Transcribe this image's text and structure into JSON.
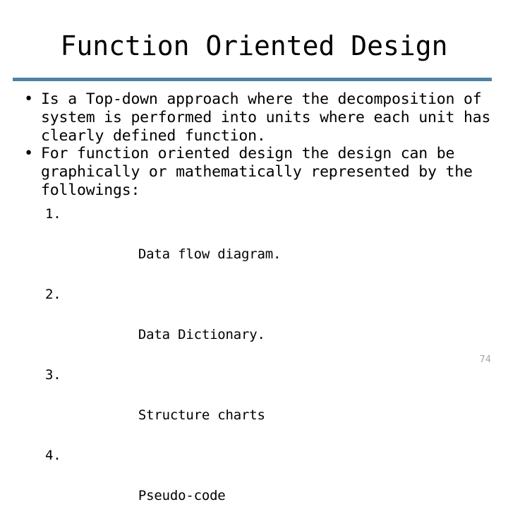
{
  "slide": {
    "title": "Function Oriented Design",
    "rule_color": "#4f81a4",
    "page_number": "74",
    "bullets": [
      {
        "marker": "•",
        "text": "Is a Top-down approach where the decomposition of system is performed into units where each unit has clearly defined function."
      },
      {
        "marker": "•",
        "text": "For function oriented design the design can be graphically or mathematically represented by the followings:"
      }
    ],
    "numbered_list": [
      {
        "number": "1.",
        "text": "Data flow diagram."
      },
      {
        "number": "2.",
        "text": "Data Dictionary."
      },
      {
        "number": "3.",
        "text": "Structure charts"
      },
      {
        "number": "4.",
        "text": "Pseudo-code"
      }
    ]
  }
}
